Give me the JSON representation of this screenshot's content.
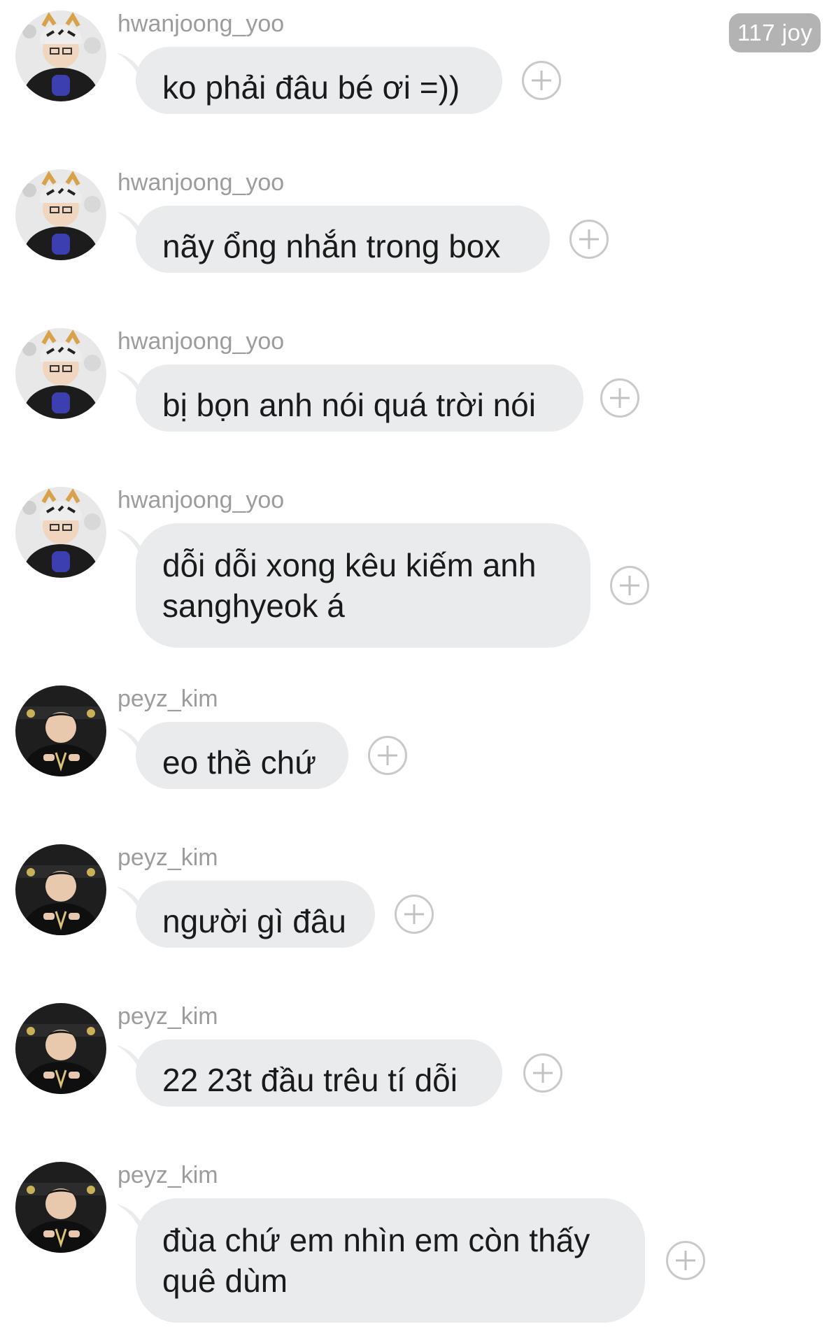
{
  "header": {
    "badge": "117 joy"
  },
  "messages": [
    {
      "sender": "hwanjoong_yoo",
      "text": "ko phải đâu bé ơi =))",
      "avatar": "avatar-hwanjoong"
    },
    {
      "sender": "hwanjoong_yoo",
      "text": "nãy ổng nhắn trong box",
      "avatar": "avatar-hwanjoong"
    },
    {
      "sender": "hwanjoong_yoo",
      "text": "bị bọn anh nói quá trời nói",
      "avatar": "avatar-hwanjoong"
    },
    {
      "sender": "hwanjoong_yoo",
      "text": "dỗi dỗi xong kêu kiếm anh sanghyeok á",
      "avatar": "avatar-hwanjoong"
    },
    {
      "sender": "peyz_kim",
      "text": "eo thề chứ",
      "avatar": "avatar-peyz"
    },
    {
      "sender": "peyz_kim",
      "text": "người gì đâu",
      "avatar": "avatar-peyz"
    },
    {
      "sender": "peyz_kim",
      "text": "22 23t đầu trêu tí dỗi",
      "avatar": "avatar-peyz"
    },
    {
      "sender": "peyz_kim",
      "text": "đùa chứ em nhìn em còn thấy quê dùm",
      "avatar": "avatar-peyz"
    }
  ],
  "icons": {
    "add_reaction": "plus-circle-icon"
  },
  "colors": {
    "bubble": "#e9ebed",
    "sender": "#9c9c9c",
    "badge": "#b3b3b3"
  }
}
